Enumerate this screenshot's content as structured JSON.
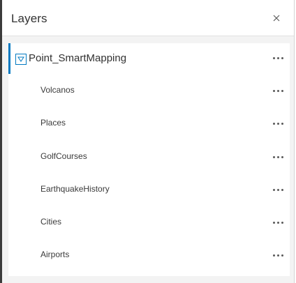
{
  "panel": {
    "title": "Layers",
    "close_icon": "close-icon"
  },
  "group": {
    "name": "Point_SmartMapping",
    "expanded": true,
    "toggle_icon": "caret-down-icon",
    "menu_icon": "ellipsis-icon"
  },
  "layers": [
    {
      "name": "Volcanos"
    },
    {
      "name": "Places"
    },
    {
      "name": "GolfCourses"
    },
    {
      "name": "EarthquakeHistory"
    },
    {
      "name": "Cities"
    },
    {
      "name": "Airports"
    }
  ],
  "colors": {
    "accent": "#0079c1",
    "panel_background": "#f3f3f3",
    "text": "#323232"
  }
}
